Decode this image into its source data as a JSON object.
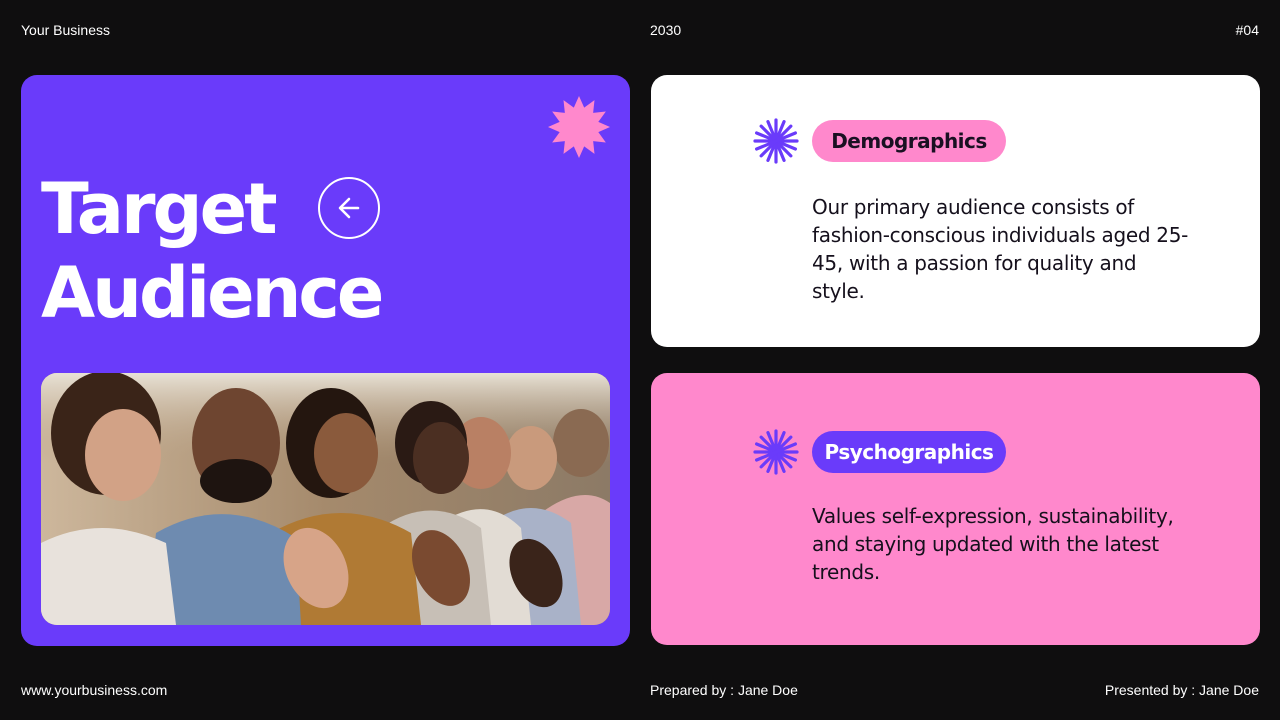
{
  "header": {
    "business": "Your Business",
    "year": "2030",
    "page": "#04"
  },
  "footer": {
    "website": "www.yourbusiness.com",
    "prepared": "Prepared by : Jane Doe",
    "presented": "Presented by : Jane Doe"
  },
  "hero": {
    "title_line1": "Target",
    "title_line2": "Audience",
    "back_icon": "arrow-left-circle-icon",
    "decor_icon": "burst-star-icon",
    "photo": "audience-clapping-photo"
  },
  "cards": {
    "demographics": {
      "label": "Demographics",
      "text": "Our primary audience consists of fashion-conscious individuals aged 25-45, with a passion for quality and style."
    },
    "psychographics": {
      "label": "Psychographics",
      "text": "Values self-expression, sustainability, and staying updated with the latest trends."
    }
  },
  "colors": {
    "background": "#0f0e0f",
    "purple": "#6a3bfa",
    "pink": "#ff88cc",
    "white": "#ffffff"
  }
}
